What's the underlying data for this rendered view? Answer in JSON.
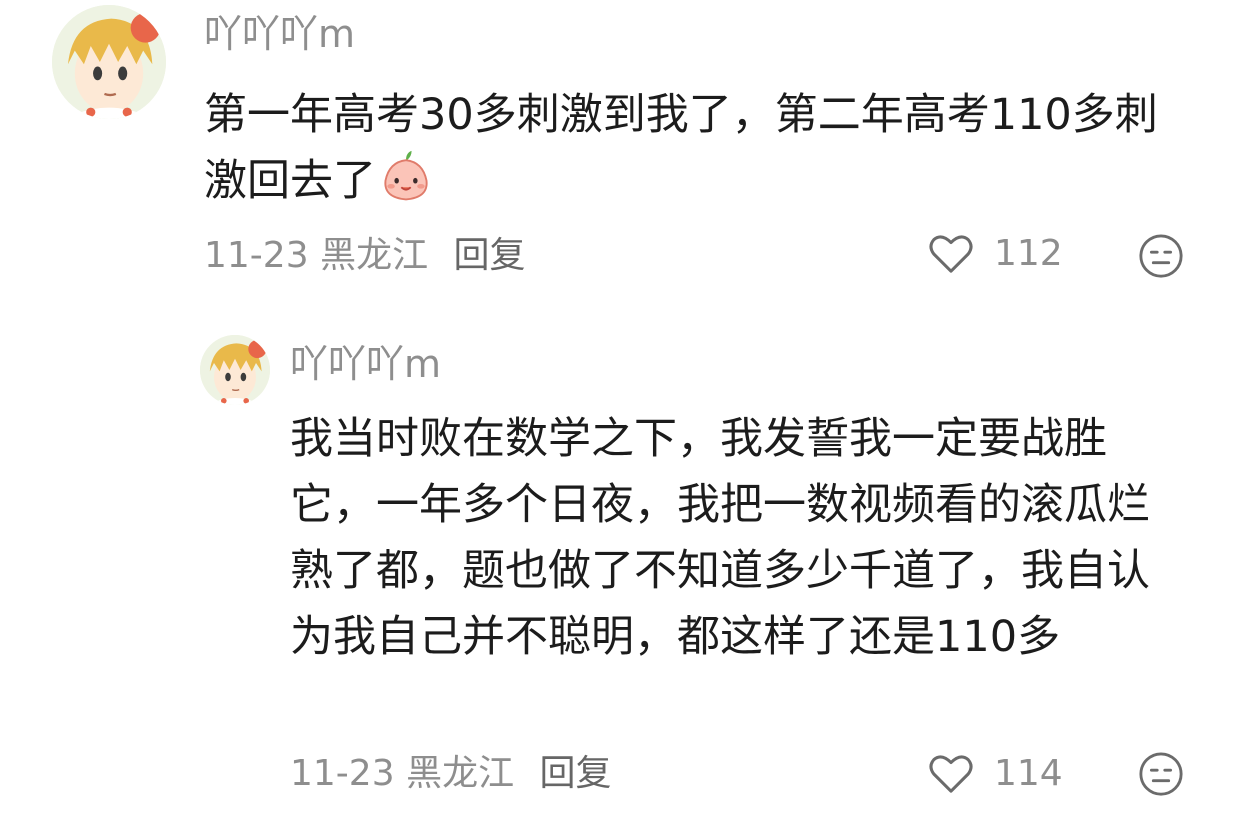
{
  "comments": [
    {
      "username": "吖吖吖m",
      "text": "第一年高考30多刺激到我了，第二年高考110多刺激回去了",
      "sticker": "peach-smile-sticker",
      "date": "11-23",
      "location": "黑龙江",
      "reply_label": "回复",
      "likes": "112"
    },
    {
      "username": "吖吖吖m",
      "text": "我当时败在数学之下，我发誓我一定要战胜它，一年多个日夜，我把一数视频看的滚瓜烂熟了都，题也做了不知道多少千道了，我自认为我自己并不聪明，都这样了还是110多",
      "date": "11-23",
      "location": "黑龙江",
      "reply_label": "回复",
      "likes": "114"
    }
  ],
  "icons": {
    "like": "heart-outline-icon",
    "dislike": "neutral-face-icon"
  },
  "colors": {
    "text": "#1c1c1c",
    "meta": "#8e8e8e",
    "avatar_hair": "#e9b94a",
    "avatar_accent": "#e8664a"
  }
}
